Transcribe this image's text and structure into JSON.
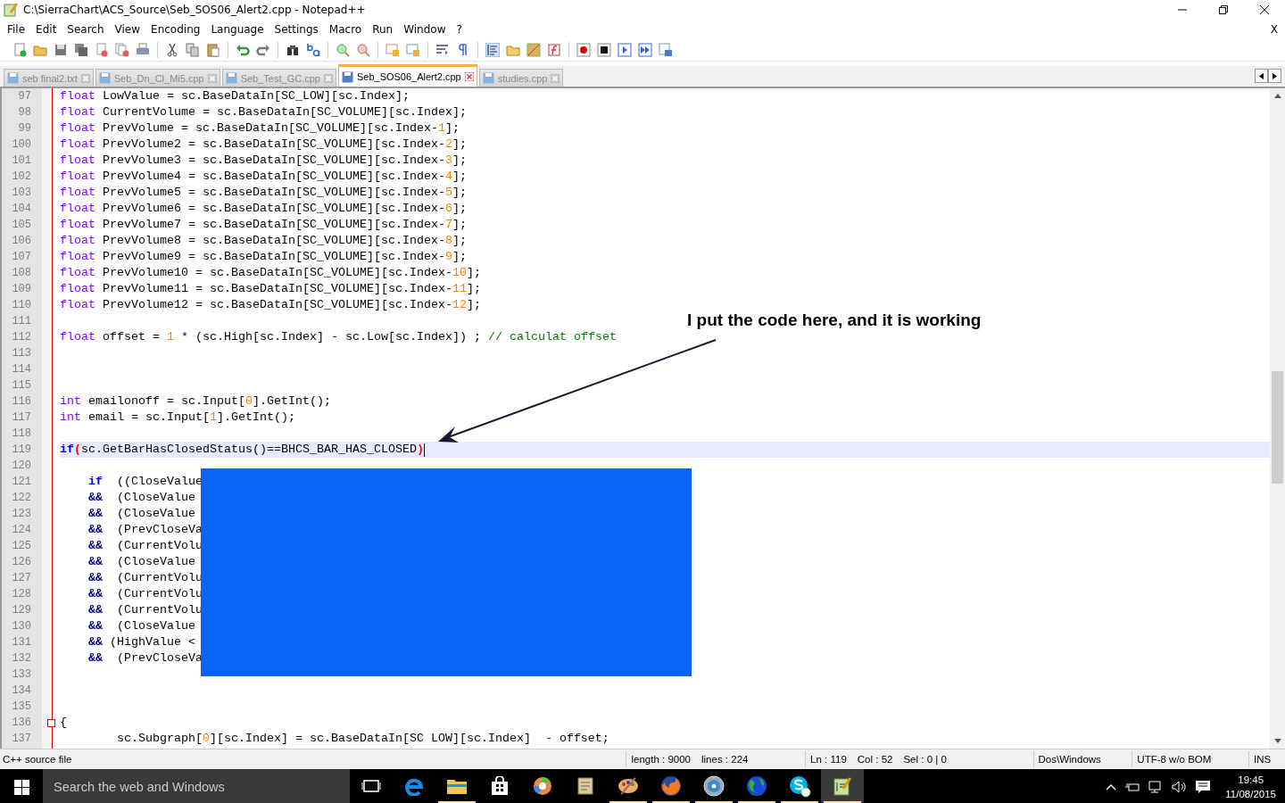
{
  "window": {
    "title": "C:\\SierraChart\\ACS_Source\\Seb_SOS06_Alert2.cpp - Notepad++"
  },
  "menu": [
    "File",
    "Edit",
    "Search",
    "View",
    "Encoding",
    "Language",
    "Settings",
    "Macro",
    "Run",
    "Window",
    "?"
  ],
  "menu_close": "X",
  "tabs": [
    {
      "label": "seb final2.txt",
      "selected": false
    },
    {
      "label": "Seb_Dn_Cl_Mi5.cpp",
      "selected": false
    },
    {
      "label": "Seb_Test_GC.cpp",
      "selected": false
    },
    {
      "label": "Seb_SOS06_Alert2.cpp",
      "selected": true
    },
    {
      "label": "studies.cpp",
      "selected": false
    }
  ],
  "editor": {
    "lines": [
      {
        "number": "97",
        "kind": "top",
        "current": false,
        "tokens": [
          {
            "kind": "type",
            "text": "float"
          },
          {
            "kind": "code",
            "text": " LowValue = sc.BaseDataIn[SC_LOW][sc.Index];"
          }
        ]
      },
      {
        "number": "98",
        "kind": "top",
        "current": false,
        "tokens": [
          {
            "kind": "type",
            "text": "float"
          },
          {
            "kind": "code",
            "text": " CurrentVolume = sc.BaseDataIn[SC_VOLUME][sc.Index];"
          }
        ]
      },
      {
        "number": "99",
        "kind": "top",
        "current": false,
        "tokens": [
          {
            "kind": "type",
            "text": "float"
          },
          {
            "kind": "code",
            "text": " PrevVolume = sc.BaseDataIn[SC_VOLUME][sc.Index-"
          },
          {
            "kind": "number",
            "text": "1"
          },
          {
            "kind": "code",
            "text": "];"
          }
        ]
      },
      {
        "number": "100",
        "kind": "top",
        "current": false,
        "tokens": [
          {
            "kind": "type",
            "text": "float"
          },
          {
            "kind": "code",
            "text": " PrevVolume2 = sc.BaseDataIn[SC_VOLUME][sc.Index-"
          },
          {
            "kind": "number",
            "text": "2"
          },
          {
            "kind": "code",
            "text": "];"
          }
        ]
      },
      {
        "number": "101",
        "kind": "top",
        "current": false,
        "tokens": [
          {
            "kind": "type",
            "text": "float"
          },
          {
            "kind": "code",
            "text": " PrevVolume3 = sc.BaseDataIn[SC_VOLUME][sc.Index-"
          },
          {
            "kind": "number",
            "text": "3"
          },
          {
            "kind": "code",
            "text": "];"
          }
        ]
      },
      {
        "number": "102",
        "kind": "top",
        "current": false,
        "tokens": [
          {
            "kind": "type",
            "text": "float"
          },
          {
            "kind": "code",
            "text": " PrevVolume4 = sc.BaseDataIn[SC_VOLUME][sc.Index-"
          },
          {
            "kind": "number",
            "text": "4"
          },
          {
            "kind": "code",
            "text": "];"
          }
        ]
      },
      {
        "number": "103",
        "kind": "top",
        "current": false,
        "tokens": [
          {
            "kind": "type",
            "text": "float"
          },
          {
            "kind": "code",
            "text": " PrevVolume5 = sc.BaseDataIn[SC_VOLUME][sc.Index-"
          },
          {
            "kind": "number",
            "text": "5"
          },
          {
            "kind": "code",
            "text": "];"
          }
        ]
      },
      {
        "number": "104",
        "kind": "top",
        "current": false,
        "tokens": [
          {
            "kind": "type",
            "text": "float"
          },
          {
            "kind": "code",
            "text": " PrevVolume6 = sc.BaseDataIn[SC_VOLUME][sc.Index-"
          },
          {
            "kind": "number",
            "text": "6"
          },
          {
            "kind": "code",
            "text": "];"
          }
        ]
      },
      {
        "number": "105",
        "kind": "top",
        "current": false,
        "tokens": [
          {
            "kind": "type",
            "text": "float"
          },
          {
            "kind": "code",
            "text": " PrevVolume7 = sc.BaseDataIn[SC_VOLUME][sc.Index-"
          },
          {
            "kind": "number",
            "text": "7"
          },
          {
            "kind": "code",
            "text": "];"
          }
        ]
      },
      {
        "number": "106",
        "kind": "top",
        "current": false,
        "tokens": [
          {
            "kind": "type",
            "text": "float"
          },
          {
            "kind": "code",
            "text": " PrevVolume8 = sc.BaseDataIn[SC_VOLUME][sc.Index-"
          },
          {
            "kind": "number",
            "text": "8"
          },
          {
            "kind": "code",
            "text": "];"
          }
        ]
      },
      {
        "number": "107",
        "kind": "top",
        "current": false,
        "tokens": [
          {
            "kind": "type",
            "text": "float"
          },
          {
            "kind": "code",
            "text": " PrevVolume9 = sc.BaseDataIn[SC_VOLUME][sc.Index-"
          },
          {
            "kind": "number",
            "text": "9"
          },
          {
            "kind": "code",
            "text": "];"
          }
        ]
      },
      {
        "number": "108",
        "kind": "top",
        "current": false,
        "tokens": [
          {
            "kind": "type",
            "text": "float"
          },
          {
            "kind": "code",
            "text": " PrevVolume10 = sc.BaseDataIn[SC_VOLUME][sc.Index-"
          },
          {
            "kind": "number",
            "text": "10"
          },
          {
            "kind": "code",
            "text": "];"
          }
        ]
      },
      {
        "number": "109",
        "kind": "top",
        "current": false,
        "tokens": [
          {
            "kind": "type",
            "text": "float"
          },
          {
            "kind": "code",
            "text": " PrevVolume11 = sc.BaseDataIn[SC_VOLUME][sc.Index-"
          },
          {
            "kind": "number",
            "text": "11"
          },
          {
            "kind": "code",
            "text": "];"
          }
        ]
      },
      {
        "number": "110",
        "kind": "top",
        "current": false,
        "tokens": [
          {
            "kind": "type",
            "text": "float"
          },
          {
            "kind": "code",
            "text": " PrevVolume12 = sc.BaseDataIn[SC_VOLUME][sc.Index-"
          },
          {
            "kind": "number",
            "text": "12"
          },
          {
            "kind": "code",
            "text": "];"
          }
        ]
      },
      {
        "number": "111",
        "current": false
      },
      {
        "number": "112",
        "kind": "top",
        "current": false,
        "tokens": [
          {
            "kind": "type",
            "text": "float"
          },
          {
            "kind": "code",
            "text": " offset = "
          },
          {
            "kind": "number",
            "text": "1"
          },
          {
            "kind": "code",
            "text": " * (sc.High[sc.Index] - sc.Low[sc.Index]) ; "
          },
          {
            "kind": "comment",
            "text": "// calculat offset"
          }
        ]
      },
      {
        "number": "113",
        "current": false
      },
      {
        "number": "114",
        "current": false
      },
      {
        "number": "115",
        "current": false
      },
      {
        "number": "116",
        "kind": "top",
        "current": false,
        "tokens": [
          {
            "kind": "type",
            "text": "int"
          },
          {
            "kind": "code",
            "text": " emailonoff = sc.Input["
          },
          {
            "kind": "number",
            "text": "0"
          },
          {
            "kind": "code",
            "text": "].GetInt();"
          }
        ]
      },
      {
        "number": "117",
        "kind": "top",
        "current": false,
        "tokens": [
          {
            "kind": "type",
            "text": "int"
          },
          {
            "kind": "code",
            "text": " email = sc.Input["
          },
          {
            "kind": "number",
            "text": "1"
          },
          {
            "kind": "code",
            "text": "].GetInt();"
          }
        ]
      },
      {
        "number": "118",
        "current": false
      },
      {
        "number": "119",
        "kind": "top",
        "current": true,
        "tokens": [
          {
            "kind": "keyword",
            "text": "if"
          },
          {
            "kind": "brace",
            "text": "("
          },
          {
            "kind": "code",
            "text": "sc.GetBarHasClosedStatus()==BHCS_BAR_HAS_CLOSED"
          },
          {
            "kind": "brace",
            "text": ")"
          }
        ]
      },
      {
        "number": "120",
        "current": false
      },
      {
        "number": "121",
        "kind": "nested",
        "current": false,
        "tokens": [
          {
            "kind": "keyword",
            "text": "if"
          },
          {
            "kind": "code",
            "text": "  ((CloseValue"
          }
        ]
      },
      {
        "number": "122",
        "kind": "nested",
        "current": false,
        "tokens": [
          {
            "kind": "op",
            "text": "&&"
          },
          {
            "kind": "code",
            "text": "  (CloseValue"
          }
        ]
      },
      {
        "number": "123",
        "kind": "nested",
        "current": false,
        "tokens": [
          {
            "kind": "op",
            "text": "&&"
          },
          {
            "kind": "code",
            "text": "  (CloseValue"
          }
        ]
      },
      {
        "number": "124",
        "kind": "nested",
        "current": false,
        "tokens": [
          {
            "kind": "op",
            "text": "&&"
          },
          {
            "kind": "code",
            "text": "  (PrevCloseVa"
          }
        ]
      },
      {
        "number": "125",
        "kind": "nested",
        "current": false,
        "tokens": [
          {
            "kind": "op",
            "text": "&&"
          },
          {
            "kind": "code",
            "text": "  (CurrentVolu"
          }
        ]
      },
      {
        "number": "126",
        "kind": "nested",
        "current": false,
        "tokens": [
          {
            "kind": "op",
            "text": "&&"
          },
          {
            "kind": "code",
            "text": "  (CloseValue"
          }
        ]
      },
      {
        "number": "127",
        "kind": "nested",
        "current": false,
        "tokens": [
          {
            "kind": "op",
            "text": "&&"
          },
          {
            "kind": "code",
            "text": "  (CurrentVolu"
          }
        ]
      },
      {
        "number": "128",
        "kind": "nested",
        "current": false,
        "tokens": [
          {
            "kind": "op",
            "text": "&&"
          },
          {
            "kind": "code",
            "text": "  (CurrentVolu"
          }
        ]
      },
      {
        "number": "129",
        "kind": "nested",
        "current": false,
        "tokens": [
          {
            "kind": "op",
            "text": "&&"
          },
          {
            "kind": "code",
            "text": "  (CurrentVolu"
          }
        ]
      },
      {
        "number": "130",
        "kind": "nested",
        "current": false,
        "tokens": [
          {
            "kind": "op",
            "text": "&&"
          },
          {
            "kind": "code",
            "text": "  (CloseValue"
          }
        ]
      },
      {
        "number": "131",
        "kind": "nested",
        "current": false,
        "tokens": [
          {
            "kind": "op",
            "text": "&&"
          },
          {
            "kind": "code",
            "text": " (HighValue <"
          }
        ]
      },
      {
        "number": "132",
        "kind": "nested",
        "current": false,
        "tokens": [
          {
            "kind": "op",
            "text": "&&"
          },
          {
            "kind": "code",
            "text": "  (PrevCloseVa"
          }
        ]
      },
      {
        "number": "133",
        "current": false
      },
      {
        "number": "134",
        "current": false
      },
      {
        "number": "135",
        "current": false
      },
      {
        "number": "136",
        "kind": "top",
        "current": false,
        "fold": true,
        "tokens": [
          {
            "kind": "code",
            "text": "{"
          }
        ]
      },
      {
        "number": "137",
        "kind": "body",
        "current": false,
        "tokens": [
          {
            "kind": "code",
            "text": "sc.Subgraph["
          },
          {
            "kind": "number",
            "text": "0"
          },
          {
            "kind": "code",
            "text": "][sc.Index] = sc.BaseDataIn[SC LOW][sc.Index]  - offset;"
          }
        ]
      }
    ]
  },
  "annotation": {
    "text": "I put the code here, and it is working"
  },
  "status_bar": {
    "file_type": "C++ source file",
    "cells": [
      [
        "length : 9000",
        "lines : 224"
      ],
      [
        "Ln : 119",
        "Col : 52",
        "Sel : 0 | 0"
      ],
      [
        "Dos\\Windows"
      ],
      [
        "UTF-8 w/o BOM"
      ],
      [
        "INS"
      ]
    ]
  },
  "taskbar": {
    "search_placeholder": "Search the web and Windows",
    "apps": [
      {
        "kind": "taskview",
        "running": false,
        "active": false
      },
      {
        "kind": "edge",
        "running": false,
        "active": false
      },
      {
        "kind": "folder",
        "running": true,
        "active": false
      },
      {
        "kind": "store",
        "running": false,
        "active": false
      },
      {
        "kind": "ball",
        "running": false,
        "active": false
      },
      {
        "kind": "scroll",
        "running": false,
        "active": false
      },
      {
        "kind": "palette",
        "running": true,
        "active": false
      },
      {
        "kind": "firefox",
        "running": true,
        "active": false
      },
      {
        "kind": "disc",
        "running": true,
        "active": false
      },
      {
        "kind": "globe",
        "running": true,
        "active": false
      },
      {
        "kind": "skype",
        "running": true,
        "active": false
      },
      {
        "kind": "notepad",
        "running": true,
        "active": true
      }
    ],
    "time": "19:45",
    "date": "11/08/2015"
  }
}
